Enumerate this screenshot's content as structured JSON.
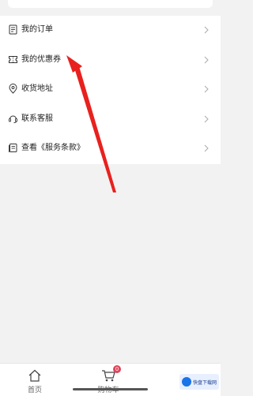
{
  "menu": {
    "items": [
      {
        "label": "我的订单",
        "icon": "order-icon"
      },
      {
        "label": "我的优惠券",
        "icon": "coupon-icon"
      },
      {
        "label": "收货地址",
        "icon": "location-icon"
      },
      {
        "label": "联系客服",
        "icon": "customer-service-icon"
      },
      {
        "label": "查看《服务条款》",
        "icon": "terms-icon"
      }
    ]
  },
  "tabbar": {
    "home_label": "首页",
    "cart_label": "购物车",
    "cart_badge": "0"
  },
  "colors": {
    "accent": "#e0435a",
    "arrow": "#e8211e",
    "background": "#f2f2f2"
  }
}
